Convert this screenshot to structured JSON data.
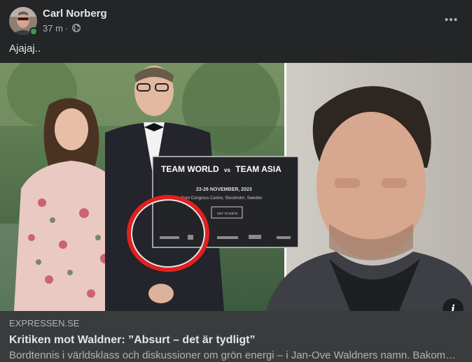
{
  "post": {
    "author": "Carl Norberg",
    "time": "37 m",
    "separator": "·",
    "visibility_icon": "globe-icon",
    "more_icon": "more-horizontal-icon",
    "text": "Ajajaj.."
  },
  "image": {
    "banner_title_left": "TEAM WORLD",
    "banner_vs": "vs",
    "banner_title_right": "TEAM ASIA",
    "banner_date": "23-26 NOVEMBER, 2023",
    "banner_venue": "...front Congress Centre, Stockholm, Sweden",
    "banner_button": "GET TICKETS"
  },
  "link": {
    "domain": "EXPRESSEN.SE",
    "title": "Kritiken mot Waldner: ”Absurt – det är tydligt”",
    "description": "Bordtennis i världsklass och diskussioner om grön energi – i Jan-Ove Waldners namn. Bakom arrangemanget står...",
    "info_icon_label": "i"
  },
  "colors": {
    "background": "#242526",
    "card": "#3a3b3c",
    "text_primary": "#e4e6eb",
    "text_secondary": "#b0b3b8",
    "online": "#31a24c",
    "highlight_circle": "#e02020"
  }
}
